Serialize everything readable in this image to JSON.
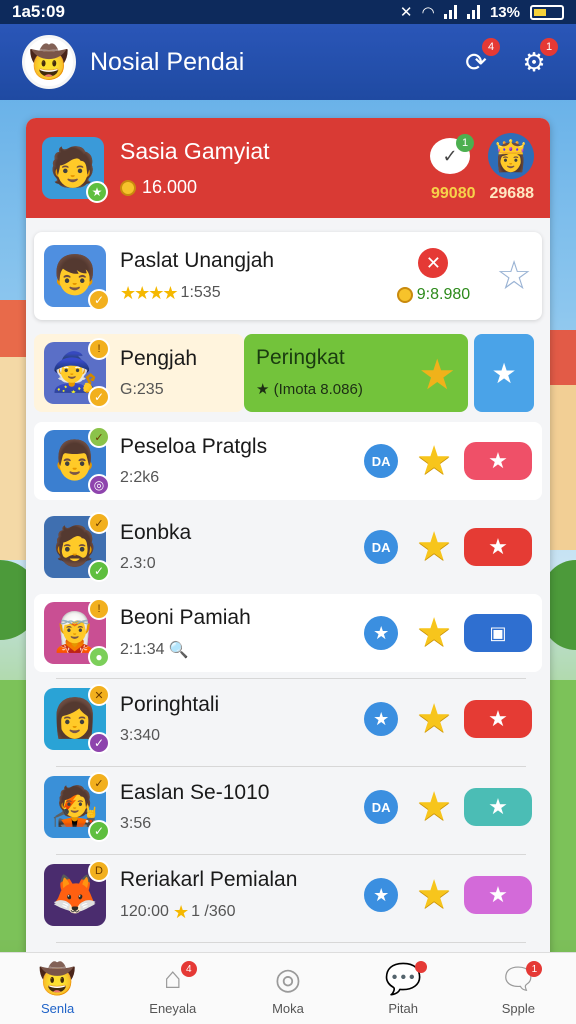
{
  "status_bar": {
    "time": "1a5:09",
    "battery": "13%"
  },
  "header": {
    "title": "Nosial Pendai",
    "notif_count": "4",
    "settings_badge": "1"
  },
  "top_card": {
    "name": "Sasia Gamyiat",
    "coins": "16.000",
    "chat_badge": "1",
    "score_a": "99080",
    "score_b": "29688"
  },
  "players": [
    {
      "name": "Paslat Unangjah",
      "sub": "1:535",
      "prize": "9:8.980"
    },
    {
      "name": "Pengjah",
      "sub": "G:235"
    },
    {
      "name": "Peseloa Pratgls",
      "sub": "2:2k6",
      "round_label": "DA"
    },
    {
      "name": "Eonbka",
      "sub": "2.3:0",
      "round_label": "DA"
    },
    {
      "name": "Beoni Pamiah",
      "sub": "2:1:34"
    },
    {
      "name": "Poringhtali",
      "sub": "3:340"
    },
    {
      "name": "Easlan Se-1010",
      "sub": "3:56",
      "round_label": "DA"
    },
    {
      "name": "Reriakarl Pemialan",
      "sub": "120:00",
      "sub2": "1 /360"
    }
  ],
  "green_card": {
    "title": "Peringkat",
    "sub": "(Imota 8.086)"
  },
  "nav": [
    {
      "label": "Senla",
      "icon": "hero-icon"
    },
    {
      "label": "Eneyala",
      "icon": "house-icon",
      "badge": "4"
    },
    {
      "label": "Moka",
      "icon": "coin-icon"
    },
    {
      "label": "Pitah",
      "icon": "chat-icon",
      "badge": ""
    },
    {
      "label": "Spple",
      "icon": "bubble-icon",
      "badge": "1"
    }
  ],
  "colors": {
    "header": "#2a56b8",
    "top_card": "#d93a34",
    "green_card": "#73c33b",
    "accent_blue": "#4aa3e8"
  }
}
